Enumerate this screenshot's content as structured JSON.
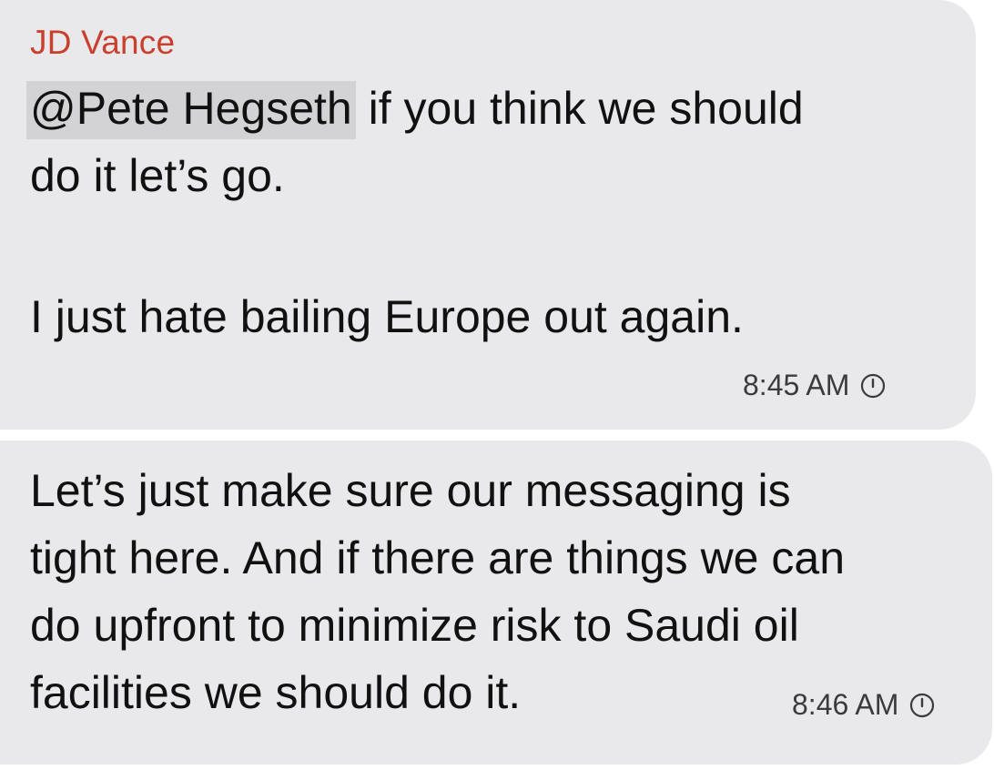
{
  "messages": [
    {
      "sender": "JD Vance",
      "mention": "@Pete Hegseth",
      "line_1_rest": " if you think we should",
      "line_2": "do it let’s go.",
      "line_3": "I just hate bailing Europe out again.",
      "time": "8:45 AM",
      "status_icon": "clock-pending-icon"
    },
    {
      "line_1": "Let’s just make sure our messaging is",
      "line_2": "tight here. And if there are things we can",
      "line_3": "do upfront to minimize risk to Saudi oil",
      "line_4": "facilities we should do it.",
      "time": "8:46 AM",
      "status_icon": "clock-pending-icon"
    }
  ],
  "colors": {
    "bubble": "#e9e9ec",
    "sender_name": "#c9402e",
    "mention_highlight": "#d3d3d6",
    "text": "#111111"
  }
}
